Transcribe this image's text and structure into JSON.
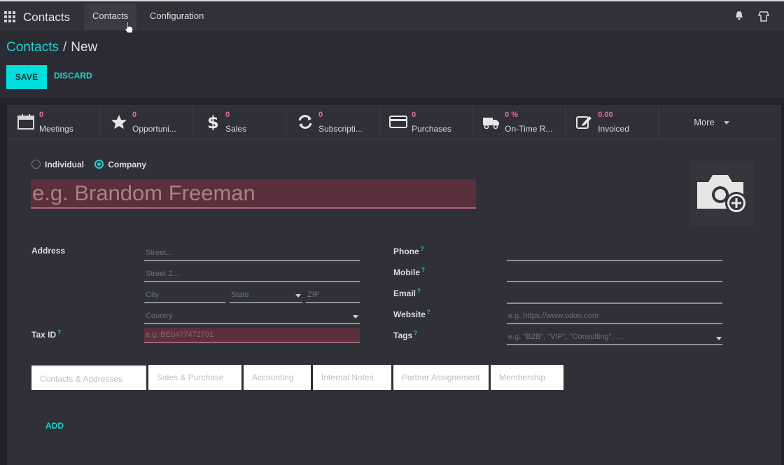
{
  "app": {
    "name": "Contacts"
  },
  "menu": {
    "contacts": "Contacts",
    "configuration": "Configuration"
  },
  "breadcrumb": {
    "parent": "Contacts",
    "separator": "/",
    "current": "New"
  },
  "buttons": {
    "save": "SAVE",
    "discard": "DISCARD"
  },
  "smart_buttons": [
    {
      "icon": "calendar-icon",
      "count": "0",
      "label": "Meetings"
    },
    {
      "icon": "star-icon",
      "count": "0",
      "label": "Opportuni..."
    },
    {
      "icon": "dollar-icon",
      "count": "0",
      "label": "Sales"
    },
    {
      "icon": "refresh-icon",
      "count": "0",
      "label": "Subscripti..."
    },
    {
      "icon": "credit-card-icon",
      "count": "0",
      "label": "Purchases"
    },
    {
      "icon": "truck-icon",
      "count": "0 %",
      "label": "On-Time R..."
    },
    {
      "icon": "edit-icon",
      "count": "0.00",
      "label": "Invoiced"
    }
  ],
  "more": "More",
  "company_type": {
    "individual": "Individual",
    "company": "Company",
    "selected": "company"
  },
  "name_placeholder": "e.g. Brandom Freeman",
  "labels": {
    "address": "Address",
    "tax_id": "Tax ID",
    "phone": "Phone",
    "mobile": "Mobile",
    "email": "Email",
    "website": "Website",
    "tags": "Tags",
    "help_mark": "?"
  },
  "placeholders": {
    "street": "Street...",
    "street2": "Street 2...",
    "city": "City",
    "state": "State",
    "zip": "ZIP",
    "country": "Country",
    "tax_id": "e.g. BE0477472701",
    "website": "e.g. https://www.odoo.com",
    "tags": "e.g. \"B2B\", \"VIP\", \"Consulting\", ..."
  },
  "tabs": [
    "Contacts & Addresses",
    "Sales & Purchase",
    "Accounting",
    "Internal Notes",
    "Partner Assignement",
    "Membership"
  ],
  "add": "ADD",
  "colors": {
    "accent": "#1fd3d0",
    "save": "#00dede",
    "required": "#5b2f3c",
    "counter": "#e46ba7"
  }
}
